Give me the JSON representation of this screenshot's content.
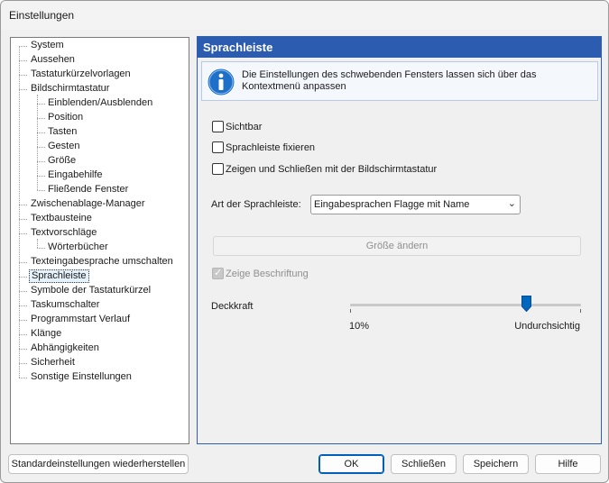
{
  "window": {
    "title": "Einstellungen"
  },
  "tree": {
    "items": [
      {
        "label": "System",
        "level": 0
      },
      {
        "label": "Aussehen",
        "level": 0
      },
      {
        "label": "Tastaturkürzelvorlagen",
        "level": 0
      },
      {
        "label": "Bildschirmtastatur",
        "level": 0
      },
      {
        "label": "Einblenden/Ausblenden",
        "level": 1
      },
      {
        "label": "Position",
        "level": 1
      },
      {
        "label": "Tasten",
        "level": 1
      },
      {
        "label": "Gesten",
        "level": 1
      },
      {
        "label": "Größe",
        "level": 1
      },
      {
        "label": "Eingabehilfe",
        "level": 1
      },
      {
        "label": "Fließende Fenster",
        "level": 1
      },
      {
        "label": "Zwischenablage-Manager",
        "level": 0
      },
      {
        "label": "Textbausteine",
        "level": 0
      },
      {
        "label": "Textvorschläge",
        "level": 0
      },
      {
        "label": "Wörterbücher",
        "level": 1
      },
      {
        "label": "Texteingabesprache umschalten",
        "level": 0
      },
      {
        "label": "Sprachleiste",
        "level": 0,
        "selected": true
      },
      {
        "label": "Symbole der Tastaturkürzel",
        "level": 0
      },
      {
        "label": "Taskumschalter",
        "level": 0
      },
      {
        "label": "Programmstart Verlauf",
        "level": 0
      },
      {
        "label": "Klänge",
        "level": 0
      },
      {
        "label": "Abhängigkeiten",
        "level": 0
      },
      {
        "label": "Sicherheit",
        "level": 0
      },
      {
        "label": "Sonstige Einstellungen",
        "level": 0
      }
    ]
  },
  "panel": {
    "header": "Sprachleiste",
    "info": "Die Einstellungen des schwebenden Fensters lassen sich über das Kontextmenü anpassen",
    "checkboxes": {
      "visible": {
        "label": "Sichtbar",
        "checked": false
      },
      "pin": {
        "label": "Sprachleiste fixieren",
        "checked": false
      },
      "show_with_keyboard": {
        "label": "Zeigen und Schließen mit der Bildschirmtastatur",
        "checked": false
      },
      "show_caption": {
        "label": "Zeige Beschriftung",
        "checked": true,
        "disabled": true
      }
    },
    "type_label": "Art der Sprachleiste:",
    "type_value": "Eingabesprachen Flagge mit Name",
    "resize_button": "Größe ändern",
    "opacity": {
      "label": "Deckkraft",
      "min_label": "10%",
      "max_label": "Undurchsichtig",
      "value_fraction": 0.76
    }
  },
  "buttons": {
    "restore": "Standardeinstellungen wiederherstellen",
    "ok": "OK",
    "close": "Schließen",
    "save": "Speichern",
    "help": "Hilfe"
  },
  "colors": {
    "accent": "#2b5caf",
    "info_icon": "#1e6fc8"
  }
}
